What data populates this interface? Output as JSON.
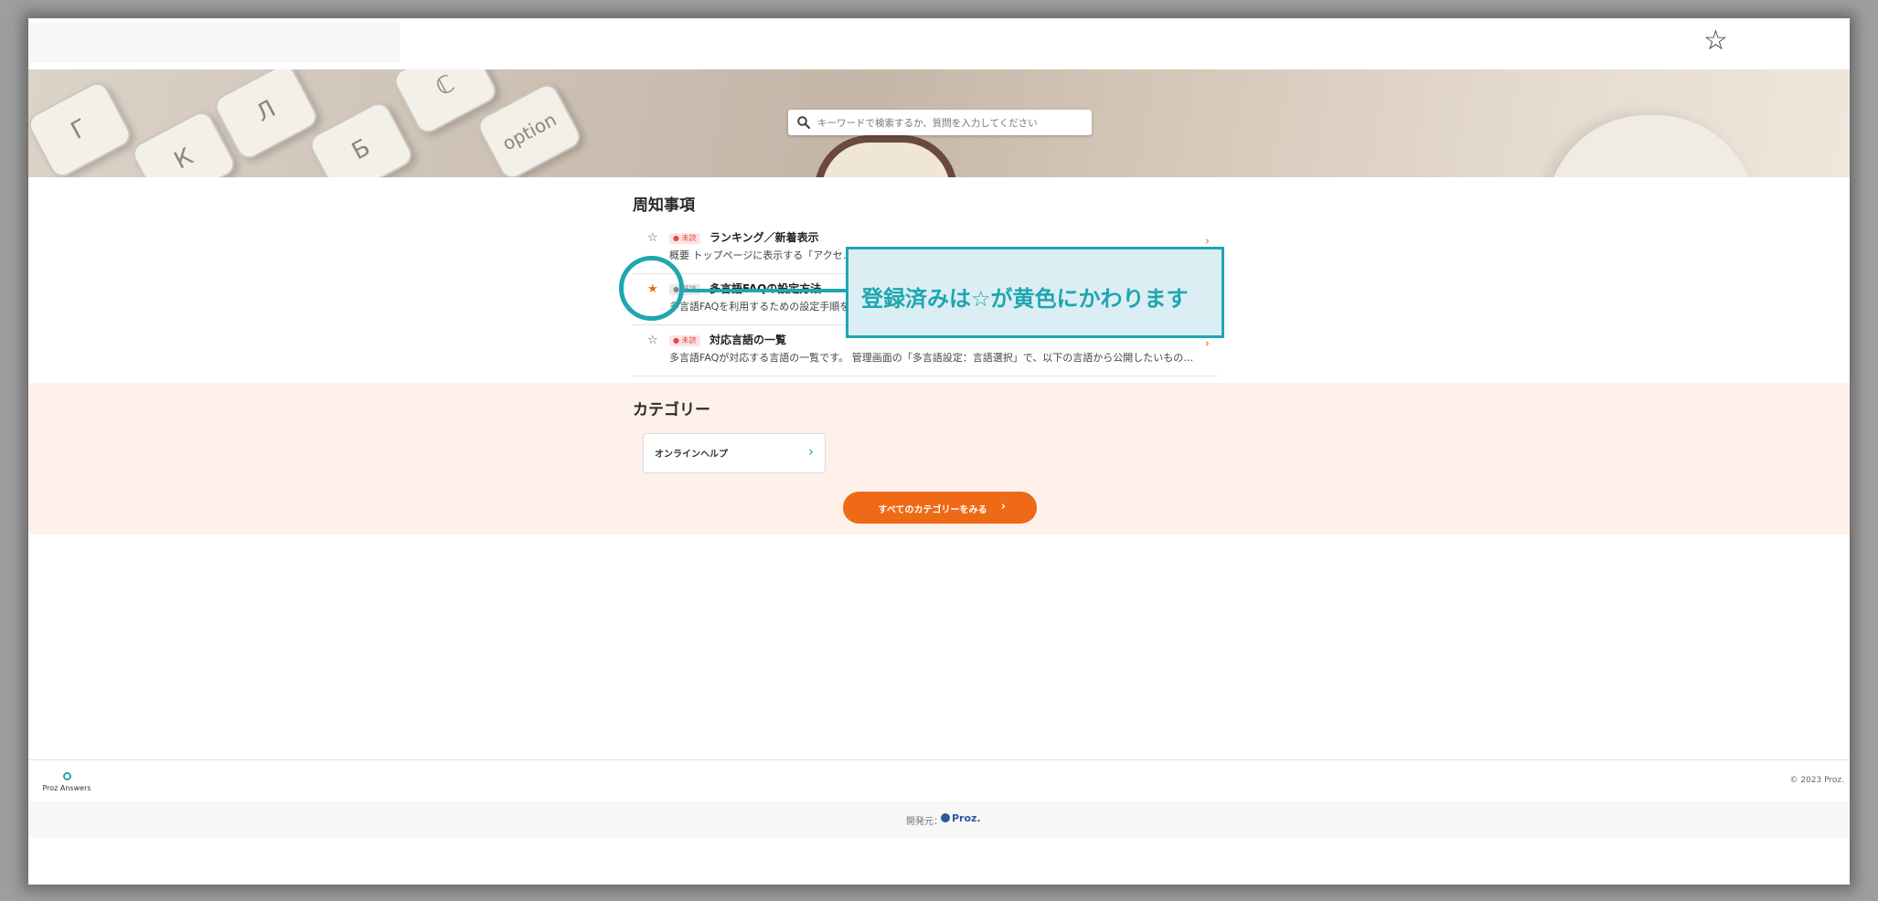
{
  "header": {
    "star_icon": "☆"
  },
  "search": {
    "placeholder": "キーワードで検索するか、質問を入力してください"
  },
  "hero": {
    "keys": [
      "Г",
      "К",
      "Л",
      "Б",
      "ℂ",
      "option"
    ]
  },
  "notices": {
    "title": "周知事項",
    "items": [
      {
        "star": "☆",
        "favorited": false,
        "badge": "● 未読",
        "title": "ランキング／新着表示",
        "desc": "概要 トップページに表示する「アクセ…",
        "chevron": "›"
      },
      {
        "star": "★",
        "favorited": true,
        "badge": "● 既読",
        "title": "多言語FAQの設定方法",
        "desc": "多言語FAQを利用するための設定手順を…",
        "chevron": "›"
      },
      {
        "star": "☆",
        "favorited": false,
        "badge": "● 未読",
        "title": "対応言語の一覧",
        "desc": "多言語FAQが対応する言語の一覧です。 管理画面の「多言語設定：言語選択」で、以下の言語から公開したいものを…",
        "chevron": "›"
      }
    ]
  },
  "categories": {
    "title": "カテゴリー",
    "items": [
      {
        "label": "オンラインヘルプ",
        "chevron": "›"
      }
    ],
    "all_button": {
      "label": "すべてのカテゴリーをみる",
      "chevron": "›"
    }
  },
  "footer": {
    "brand": "Proz Answers",
    "copyright": "© 2023 Proz.",
    "developer_label": "開発元：",
    "developer_name": "Proz."
  },
  "annotation": {
    "text": "登録済みは☆が黄色にかわります"
  },
  "colors": {
    "accent": "#ef6a16",
    "callout": "#1fa6b0",
    "category_band": "#fdf1ea"
  }
}
